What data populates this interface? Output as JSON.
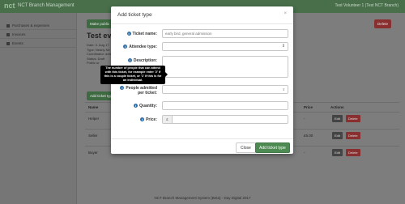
{
  "app": {
    "logo": "nct",
    "brand": "NCT Branch Management",
    "user": "Test Volunteer 1 (Test NCT Branch)"
  },
  "sidebar": {
    "items": [
      {
        "label": "Purchases & expenses",
        "icon": "cart-icon"
      },
      {
        "label": "Invoices",
        "icon": "invoice-icon"
      },
      {
        "label": "Events",
        "icon": "calendar-icon"
      }
    ]
  },
  "page": {
    "make_public": "Make public",
    "delete": "Delete",
    "title": "Test eve",
    "meta": [
      "Date: 3. Aug 17",
      "Type: Nearly Ne",
      "Coordinator: adm",
      "Status: Draft",
      "Public ur"
    ],
    "add_ticket_type": "Add ticket typ",
    "table": {
      "headers": {
        "name": "Name",
        "price": "Price",
        "actions": "Actions"
      },
      "rows": [
        {
          "name": "Helper",
          "price": "-",
          "dash": "",
          "edit": "Edit",
          "delete": "Delete"
        },
        {
          "name": "Seller",
          "price": "£5.00",
          "dash": "-",
          "edit": "Edit",
          "delete": "Delete"
        },
        {
          "name": "Buyer",
          "price": "-",
          "dash": "",
          "edit": "Edit",
          "delete": "Delete"
        }
      ]
    },
    "footer": "NCT Branch Management System (Beta) - Day Digital 2017"
  },
  "modal": {
    "title": "Add ticket type",
    "close": "×",
    "fields": {
      "ticket_name": {
        "label": "Ticket name:",
        "placeholder": "early bird, general admission"
      },
      "attendee_type": {
        "label": "Attendee type:",
        "value": ""
      },
      "description": {
        "label": "Description:"
      },
      "people_admitted": {
        "label_line1": "People admitted",
        "label_line2": "per ticket:"
      },
      "quantity": {
        "label": "Quantity:"
      },
      "price": {
        "label": "Price:",
        "currency": "£"
      }
    },
    "buttons": {
      "close": "Close",
      "add": "Add ticket type"
    },
    "tooltip": "The number of people that can attend with this ticket, for example enter '2' if this is a couple ticket, or '1' if this is for an individual."
  },
  "colors": {
    "primary_green": "#4d8b52",
    "danger_red": "#a33a3a",
    "info_blue": "#2f6fa8"
  }
}
